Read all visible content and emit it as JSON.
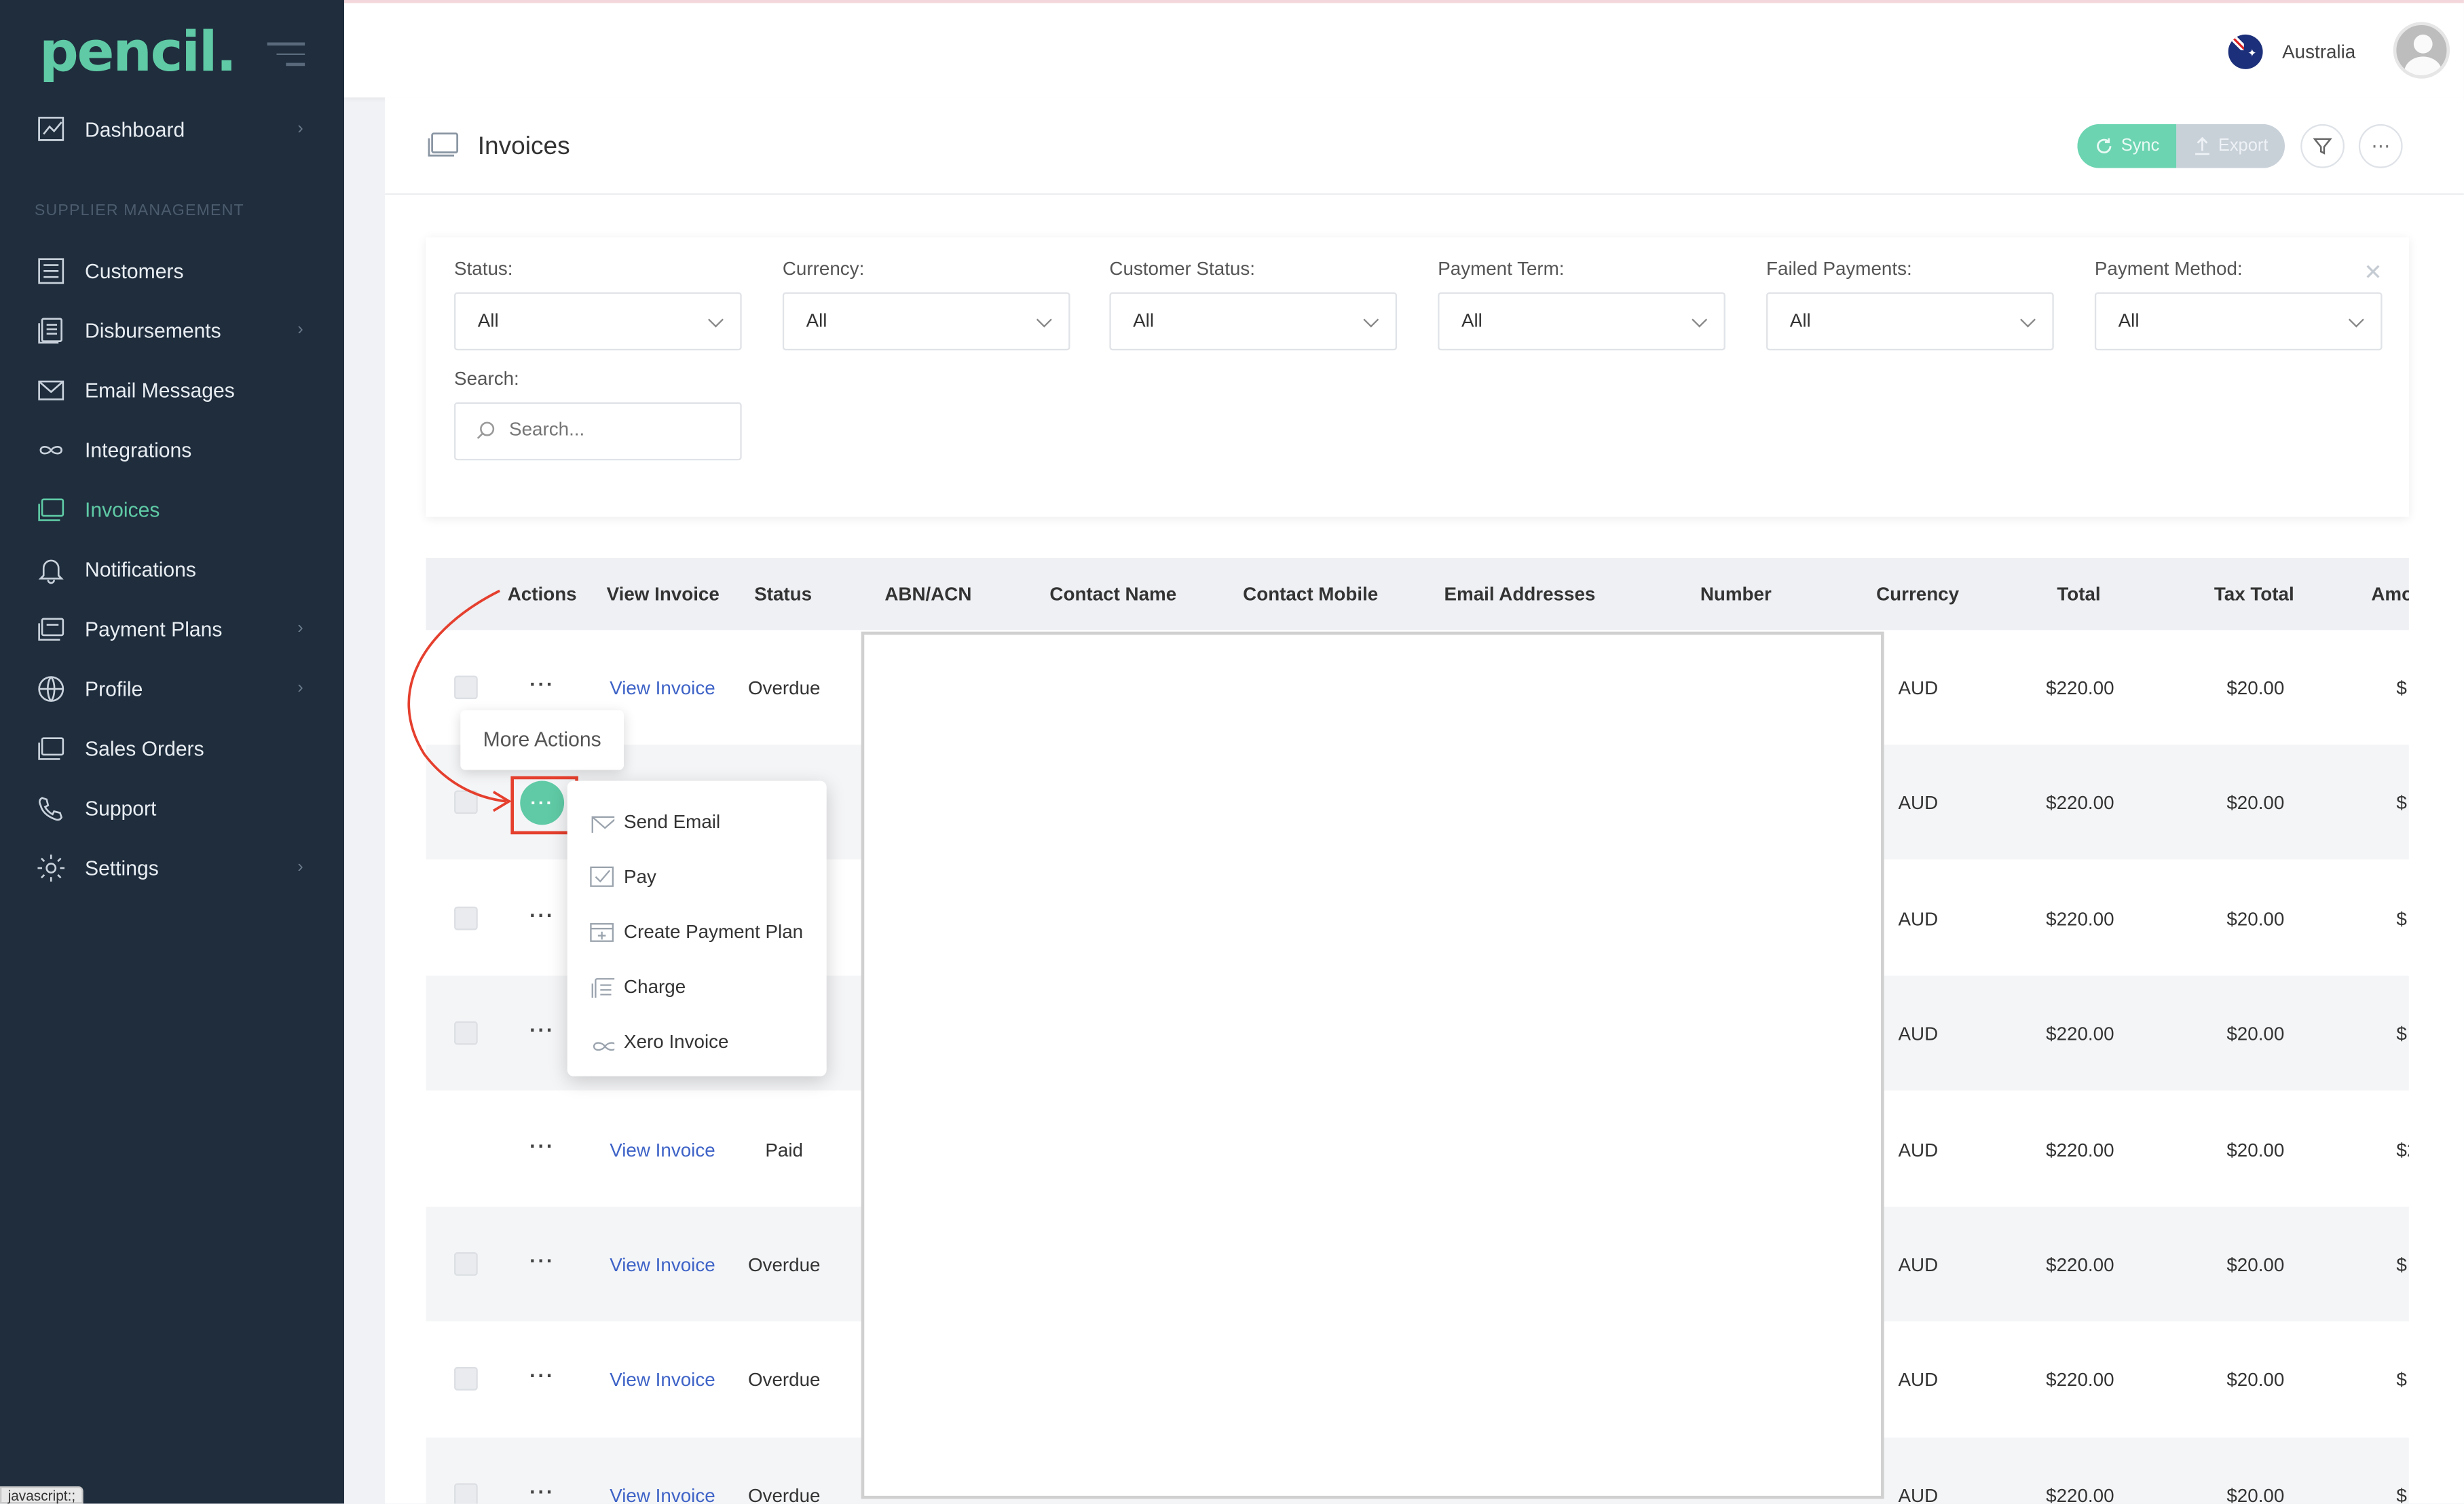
{
  "sidebar": {
    "logo": "pencil.",
    "section_label": "SUPPLIER MANAGEMENT",
    "items": [
      {
        "label": "Dashboard",
        "icon": "chart-icon",
        "has_chevron": true
      },
      {
        "label": "Customers",
        "icon": "list-icon",
        "has_chevron": false
      },
      {
        "label": "Disbursements",
        "icon": "stack-icon",
        "has_chevron": true
      },
      {
        "label": "Email Messages",
        "icon": "envelope-icon",
        "has_chevron": false
      },
      {
        "label": "Integrations",
        "icon": "infinity-icon",
        "has_chevron": false
      },
      {
        "label": "Invoices",
        "icon": "invoice-icon",
        "has_chevron": false,
        "active": true
      },
      {
        "label": "Notifications",
        "icon": "bell-icon",
        "has_chevron": false
      },
      {
        "label": "Payment Plans",
        "icon": "plans-icon",
        "has_chevron": true
      },
      {
        "label": "Profile",
        "icon": "globe-icon",
        "has_chevron": true
      },
      {
        "label": "Sales Orders",
        "icon": "orders-icon",
        "has_chevron": false
      },
      {
        "label": "Support",
        "icon": "phone-icon",
        "has_chevron": false
      },
      {
        "label": "Settings",
        "icon": "gear-icon",
        "has_chevron": true
      }
    ],
    "chevron": "›",
    "status_text": "javascript:;"
  },
  "header": {
    "region": "Australia",
    "region_flag": "australia-flag-icon"
  },
  "page": {
    "title": "Invoices",
    "sync_label": "Sync",
    "export_label": "Export",
    "filter_icon": "filter-icon",
    "more_label": "⋯"
  },
  "filters": {
    "status": {
      "label": "Status:",
      "value": "All"
    },
    "currency": {
      "label": "Currency:",
      "value": "All"
    },
    "customer_status": {
      "label": "Customer Status:",
      "value": "All"
    },
    "payment_term": {
      "label": "Payment Term:",
      "value": "All"
    },
    "failed_payments": {
      "label": "Failed Payments:",
      "value": "All"
    },
    "payment_method": {
      "label": "Payment Method:",
      "value": "All"
    },
    "search": {
      "label": "Search:",
      "placeholder": "Search..."
    },
    "close": "✕"
  },
  "table": {
    "columns": [
      "Actions",
      "View Invoice",
      "Status",
      "ABN/ACN",
      "Contact Name",
      "Contact Mobile",
      "Email Addresses",
      "Number",
      "Currency",
      "Total",
      "Tax Total",
      "Amo"
    ],
    "rows": [
      {
        "actions": "···",
        "view": "View Invoice",
        "status": "Overdue",
        "currency": "AUD",
        "total": "$220.00",
        "tax": "$20.00",
        "amount": "$",
        "checkbox": true
      },
      {
        "actions": "···",
        "view": "",
        "status": "",
        "currency": "AUD",
        "total": "$220.00",
        "tax": "$20.00",
        "amount": "$",
        "checkbox": true
      },
      {
        "actions": "···",
        "view": "",
        "status": "",
        "currency": "AUD",
        "total": "$220.00",
        "tax": "$20.00",
        "amount": "$",
        "checkbox": true
      },
      {
        "actions": "···",
        "view": "",
        "status": "",
        "currency": "AUD",
        "total": "$220.00",
        "tax": "$20.00",
        "amount": "$",
        "checkbox": true
      },
      {
        "actions": "···",
        "view": "View Invoice",
        "status": "Paid",
        "currency": "AUD",
        "total": "$220.00",
        "tax": "$20.00",
        "amount": "$2",
        "checkbox": false
      },
      {
        "actions": "···",
        "view": "View Invoice",
        "status": "Overdue",
        "currency": "AUD",
        "total": "$220.00",
        "tax": "$20.00",
        "amount": "$",
        "checkbox": true
      },
      {
        "actions": "···",
        "view": "View Invoice",
        "status": "Overdue",
        "currency": "AUD",
        "total": "$220.00",
        "tax": "$20.00",
        "amount": "$",
        "checkbox": true
      },
      {
        "actions": "···",
        "view": "View Invoice",
        "status": "Overdue",
        "currency": "AUD",
        "total": "$220.00",
        "tax": "$20.00",
        "amount": "$",
        "checkbox": true
      }
    ]
  },
  "popup": {
    "tooltip": "More Actions",
    "active_button": "···",
    "menu": [
      {
        "label": "Send Email",
        "icon": "envelope-icon"
      },
      {
        "label": "Pay",
        "icon": "check-icon"
      },
      {
        "label": "Create Payment Plan",
        "icon": "calendar-plus-icon"
      },
      {
        "label": "Charge",
        "icon": "stack-icon"
      },
      {
        "label": "Xero Invoice",
        "icon": "infinity-icon"
      }
    ]
  },
  "colors": {
    "sidebar_bg": "#1f2d3d",
    "accent": "#5fcaa5",
    "link": "#3e63c7",
    "highlight": "#e53f2e"
  }
}
